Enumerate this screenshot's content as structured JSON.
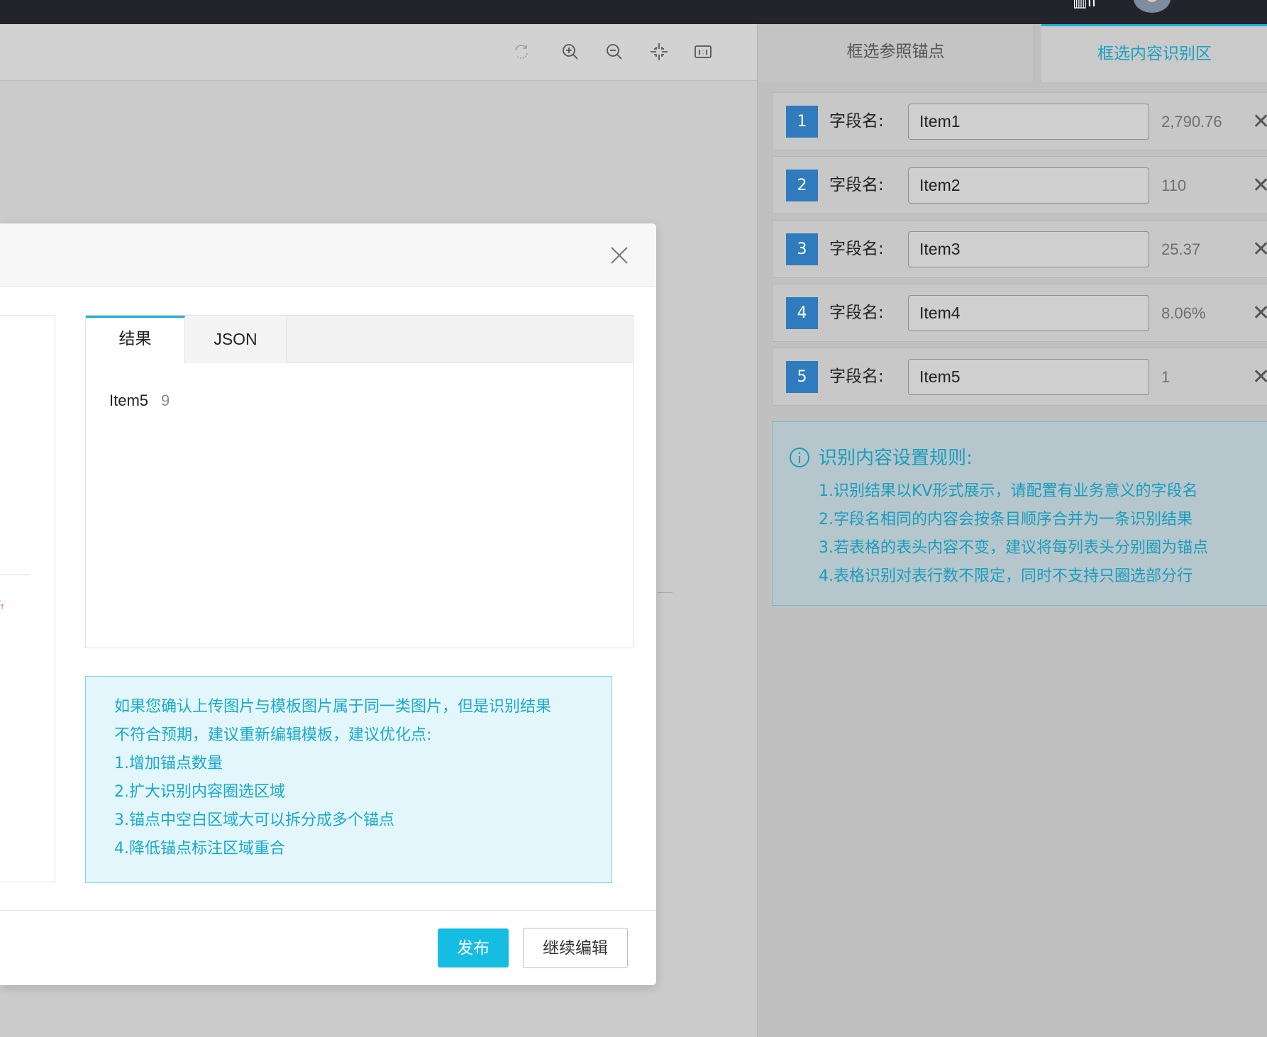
{
  "topbar": {},
  "toolbar": {
    "tools": [
      "refresh-icon",
      "zoom-in-icon",
      "zoom-out-icon",
      "fit-screen-icon",
      "actual-size-icon"
    ]
  },
  "right_panel": {
    "tabs": [
      "框选参照锚点",
      "框选内容识别区"
    ],
    "active_tab": "框选内容识别区",
    "fields": [
      {
        "num": "1",
        "label": "字段名:",
        "value": "Item1",
        "result": "2,790.76"
      },
      {
        "num": "2",
        "label": "字段名:",
        "value": "Item2",
        "result": "110"
      },
      {
        "num": "3",
        "label": "字段名:",
        "value": "Item3",
        "result": "25.37"
      },
      {
        "num": "4",
        "label": "字段名:",
        "value": "Item4",
        "result": "8.06%"
      },
      {
        "num": "5",
        "label": "字段名:",
        "value": "Item5",
        "result": "1"
      }
    ],
    "rules": {
      "title": "识别内容设置规则:",
      "items": [
        "1.识别结果以KV形式展示，请配置有业务意义的字段名",
        "2.字段名相同的内容会按条目顺序合并为一条识别结果",
        "3.若表格的表头内容不变，建议将每列表头分别圈为锚点",
        "4.表格识别对表行数不限定，同时不支持只圈选部分行"
      ]
    }
  },
  "modal": {
    "tabs": [
      "结果",
      "JSON"
    ],
    "active_tab": "结果",
    "result": {
      "key": "Item5",
      "value": "9"
    },
    "tip": [
      "如果您确认上传图片与模板图片属于同一类图片，但是识别结果",
      "不符合预期，建议重新编辑模板，建议优化点:",
      "1.增加锚点数量",
      "2.扩大识别内容圈选区域",
      "3.锚点中空白区域大可以拆分成多个锚点",
      "4.降低锚点标注区域重合"
    ],
    "buttons": {
      "publish": "发布",
      "continue_edit": "继续编辑"
    }
  },
  "colors": {
    "accent": "#16bde3",
    "field_badge": "#2f7bbd",
    "tip_text": "#1aa9cd"
  }
}
